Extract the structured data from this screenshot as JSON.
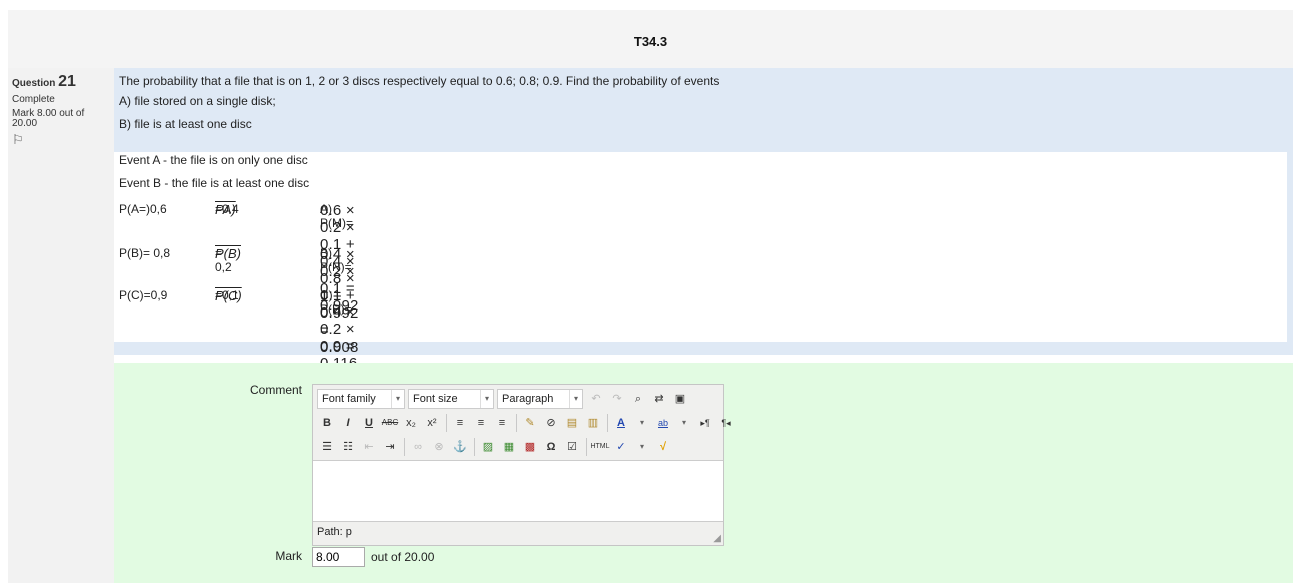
{
  "page": {
    "title": "T34.3"
  },
  "info": {
    "question_label": "Question",
    "question_number": "21",
    "state": "Complete",
    "mark_text": "Mark 8.00 out of 20.00",
    "flag_icon": "flag-icon"
  },
  "question": {
    "line1": "The probability that a file that is on 1, 2 or 3 discs respectively equal to 0.6; 0.8; 0.9. Find the probability of events",
    "line2": "A) file stored on a single disk;",
    "line3": "B) file is at least one disc"
  },
  "answer": {
    "event_a": "Event A - the file is on only one disc",
    "event_b": "Event B - the file is at least one disc",
    "rows": [
      {
        "p": "P(A=)0,6",
        "comp_sym": "PA)",
        "comp_val": "=0.4",
        "sol_label": "A) P(M)=",
        "sol_expr": "0.6 × 0.2 × 0.1 + 0.4 × 0.8 × 0.1 + 0.4 × 0.2 × 0.9 = 0.116"
      },
      {
        "p": "P(B)= 0,8",
        "comp_sym": "P(B)",
        "comp_val": "= 0,2",
        "sol_label": "B) P(N)=",
        "sol_expr": "0.4 × 0.2 × 0.1 = 0.992"
      },
      {
        "p": "P(C)=0,9",
        "comp_sym": "P(C)",
        "comp_val": "=0,1",
        "sol_label": "C) P(D)= ",
        "sol_expr": "1 − 0.992 = 0.008"
      }
    ]
  },
  "feedback": {
    "comment_label": "Comment",
    "editor": {
      "font_family": "Font family",
      "font_size": "Font size",
      "format": "Paragraph",
      "path": "Path: p"
    },
    "mark_label": "Mark",
    "mark_value": "8.00",
    "out_of": "out of 20.00"
  }
}
